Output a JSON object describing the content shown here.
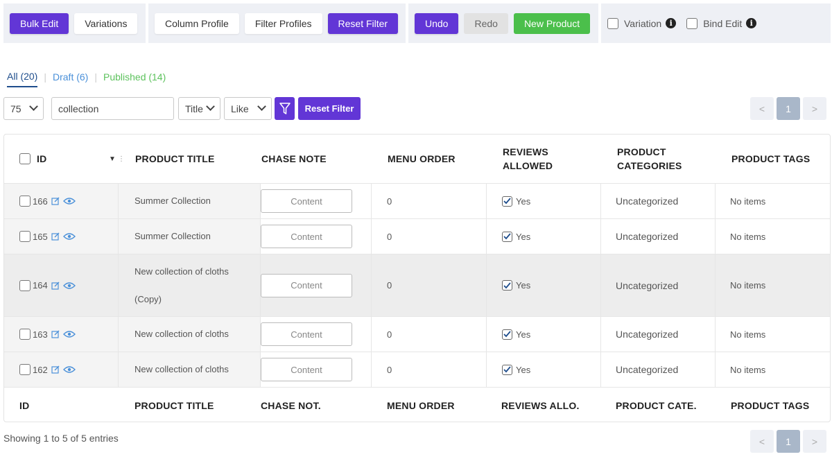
{
  "toolbar": {
    "bulk_edit": "Bulk Edit",
    "variations": "Variations",
    "column_profile": "Column Profile",
    "filter_profiles": "Filter Profiles",
    "reset_filter": "Reset Filter",
    "undo": "Undo",
    "redo": "Redo",
    "new_product": "New Product",
    "variation_label": "Variation",
    "bind_edit_label": "Bind Edit"
  },
  "status_tabs": {
    "all": "All (20)",
    "draft": "Draft (6)",
    "published": "Published (14)"
  },
  "filters": {
    "per_page": "75",
    "search_value": "collection",
    "field": "Title",
    "operator": "Like",
    "reset_label": "Reset Filter"
  },
  "pagination": {
    "prev": "<",
    "current": "1",
    "next": ">"
  },
  "table": {
    "headers": {
      "id": "ID",
      "title": "PRODUCT TITLE",
      "chase_note": "CHASE NOTE",
      "menu_order": "MENU ORDER",
      "reviews_1": "REVIEWS",
      "reviews_2": "ALLOWED",
      "categories_1": "PRODUCT",
      "categories_2": "CATEGORIES",
      "tags": "PRODUCT TAGS"
    },
    "footer_headers": {
      "id": "ID",
      "title": "PRODUCT TITLE",
      "chase_note": "CHASE NOT.",
      "menu_order": "MENU ORDER",
      "reviews": "REVIEWS ALLO.",
      "categories": "PRODUCT CATE.",
      "tags": "PRODUCT TAGS"
    },
    "rows": [
      {
        "id": "166",
        "title": "Summer Collection",
        "title_2": "",
        "note": "Content",
        "menu_order": "0",
        "reviews": "Yes",
        "category": "Uncategorized",
        "tags": "No items"
      },
      {
        "id": "165",
        "title": "Summer Collection",
        "title_2": "",
        "note": "Content",
        "menu_order": "0",
        "reviews": "Yes",
        "category": "Uncategorized",
        "tags": "No items"
      },
      {
        "id": "164",
        "title": "New collection of cloths",
        "title_2": "(Copy)",
        "note": "Content",
        "menu_order": "0",
        "reviews": "Yes",
        "category": "Uncategorized",
        "tags": "No items"
      },
      {
        "id": "163",
        "title": "New collection of cloths",
        "title_2": "",
        "note": "Content",
        "menu_order": "0",
        "reviews": "Yes",
        "category": "Uncategorized",
        "tags": "No items"
      },
      {
        "id": "162",
        "title": "New collection of cloths",
        "title_2": "",
        "note": "Content",
        "menu_order": "0",
        "reviews": "Yes",
        "category": "Uncategorized",
        "tags": "No items"
      }
    ]
  },
  "footer": {
    "showing": "Showing 1 to 5 of 5 entries"
  },
  "colors": {
    "primary": "#6236d6",
    "success": "#4bbf4b",
    "link": "#4a90d9"
  }
}
